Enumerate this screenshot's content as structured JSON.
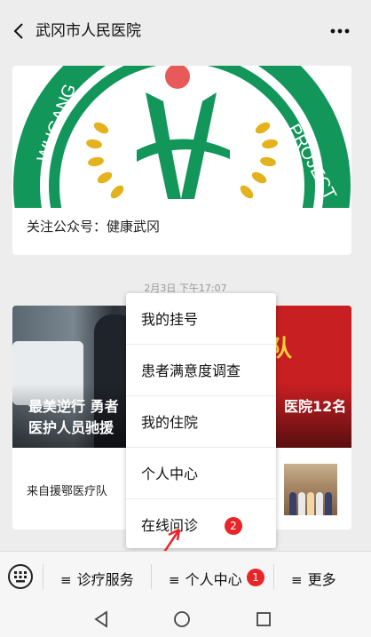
{
  "header": {
    "title": "武冈市人民医院"
  },
  "card1": {
    "caption": "关注公众号：健康武冈",
    "logo_text": "WUGANG H PROJECT"
  },
  "timestamp": "2月3日 下午17:07",
  "card2": {
    "title_left": "最美逆行  勇者",
    "title_right": "医院12名",
    "title_line2": "医护人员驰援",
    "bus_banner": "疗队",
    "subtitle": "来自援鄂医疗队"
  },
  "popup_menu": {
    "items": [
      {
        "label": "我的挂号"
      },
      {
        "label": "患者满意度调查"
      },
      {
        "label": "我的住院"
      },
      {
        "label": "个人中心"
      },
      {
        "label": "在线问诊"
      }
    ],
    "badge": "2"
  },
  "menubar": {
    "items": [
      {
        "label": "诊疗服务",
        "icon": "hamburger-icon"
      },
      {
        "label": "个人中心",
        "icon": "hamburger-icon"
      },
      {
        "label": "更多",
        "icon": "hamburger-icon"
      }
    ],
    "badge": "1"
  },
  "colors": {
    "accent_green": "#13965a",
    "badge_red": "#e8262a",
    "logo_gold": "#e3b21d"
  }
}
